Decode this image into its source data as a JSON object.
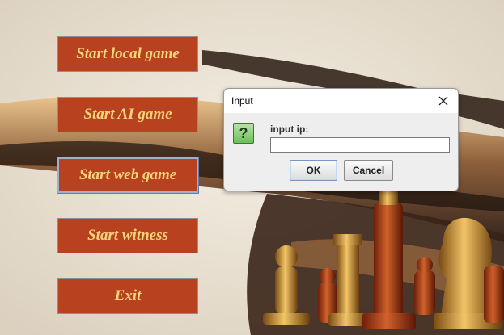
{
  "menu": {
    "start_local": "Start local game",
    "start_ai": "Start AI game",
    "start_web": "Start web game",
    "start_witness": "Start witness",
    "exit": "Exit"
  },
  "dialog": {
    "title": "Input",
    "icon": "question-icon",
    "prompt": "input ip:",
    "input_value": "",
    "ok_label": "OK",
    "cancel_label": "Cancel"
  },
  "colors": {
    "button_bg": "#b8421f",
    "button_text": "#f6d47b",
    "background": "#ece4d6"
  }
}
